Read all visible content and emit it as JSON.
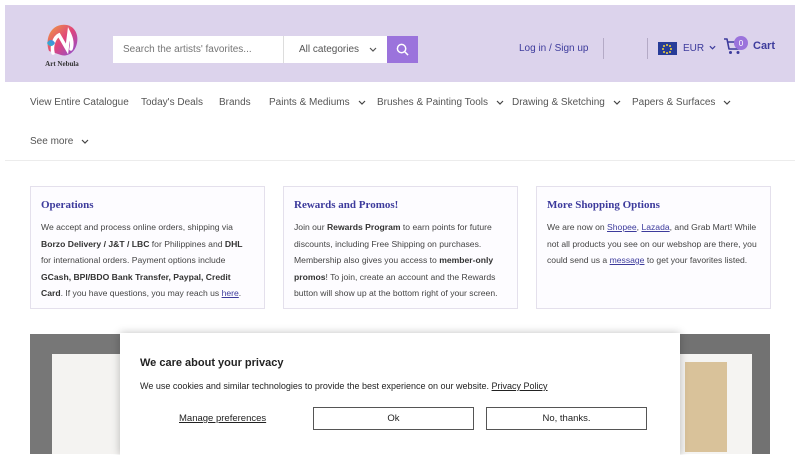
{
  "header": {
    "brand_name": "Art Nebula",
    "search": {
      "placeholder": "Search the artists' favorites...",
      "category": "All categories"
    },
    "login_label": "Log in / Sign up",
    "currency": "EUR",
    "cart": {
      "count": "0",
      "label": "Cart"
    },
    "colors": {
      "header_bg": "#dcd3ec",
      "accent": "#9b73dc",
      "link": "#3d3b9c"
    }
  },
  "nav": {
    "items": [
      {
        "label": "View Entire Catalogue"
      },
      {
        "label": "Today's Deals"
      },
      {
        "label": "Brands"
      },
      {
        "label": "Paints & Mediums"
      },
      {
        "label": "Brushes & Painting Tools"
      },
      {
        "label": "Drawing & Sketching"
      },
      {
        "label": "Papers & Surfaces"
      },
      {
        "label": "See more"
      }
    ]
  },
  "cards": [
    {
      "title": "Operations",
      "t1": "We accept and process online orders, shipping via ",
      "b1": "Borzo Delivery / J&T / LBC",
      "t2": " for Philippines and ",
      "b2": "DHL",
      "t3": " for international orders. Payment options include ",
      "b3": "GCash, BPI/BDO Bank Transfer, Paypal, Credit Card",
      "t4": ". If you have questions, you may reach us ",
      "link": "here",
      "t5": "."
    },
    {
      "title": "Rewards and Promos!",
      "t1": "Join our ",
      "b1": "Rewards Program",
      "t2": " to earn points for future discounts, including Free Shipping on purchases. Membership also gives you access to ",
      "b2": "member-only promos",
      "t3": "! To join, create an account and the Rewards button will show up at the bottom right of your screen."
    },
    {
      "title": "More Shopping Options",
      "t1": "We are now on ",
      "link1": "Shopee",
      "t2": ", ",
      "link2": "Lazada",
      "t3": ", and Grab Mart! While not all products you see on our webshop are there, you could send us a ",
      "link3": "message",
      "t4": " to get your favorites listed."
    }
  ],
  "cookie": {
    "title": "We care about your privacy",
    "text": "We use cookies and similar technologies to provide the best experience on our website. ",
    "policy_link": "Privacy Policy",
    "manage_label": "Manage preferences",
    "ok_label": "Ok",
    "decline_label": "No, thanks."
  }
}
